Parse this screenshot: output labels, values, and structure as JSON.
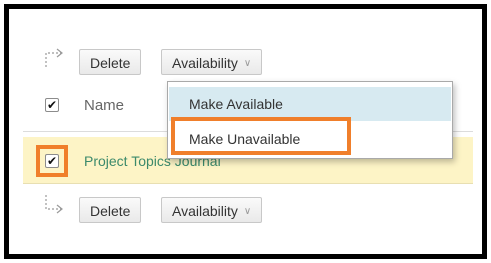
{
  "toolbar_top": {
    "delete_label": "Delete",
    "availability_label": "Availability"
  },
  "toolbar_bottom": {
    "delete_label": "Delete",
    "availability_label": "Availability"
  },
  "table": {
    "header": {
      "name_label": "Name",
      "select_all_checked": true
    },
    "rows": [
      {
        "title": "Project Topics Journal",
        "checked": true,
        "highlighted": true
      }
    ]
  },
  "availability_menu": {
    "items": [
      {
        "label": "Make Available",
        "hovered": true
      },
      {
        "label": "Make Unavailable",
        "emphasized": true
      }
    ]
  },
  "colors": {
    "highlight_row": "#fdf4c6",
    "menu_hover": "#d7eaf1",
    "annotation_orange": "#f07f2b",
    "link_green": "#3c8a6b"
  },
  "icons": {
    "checkbox_check": "✔",
    "dropdown_chevron": "double-chevron-down-icon"
  }
}
